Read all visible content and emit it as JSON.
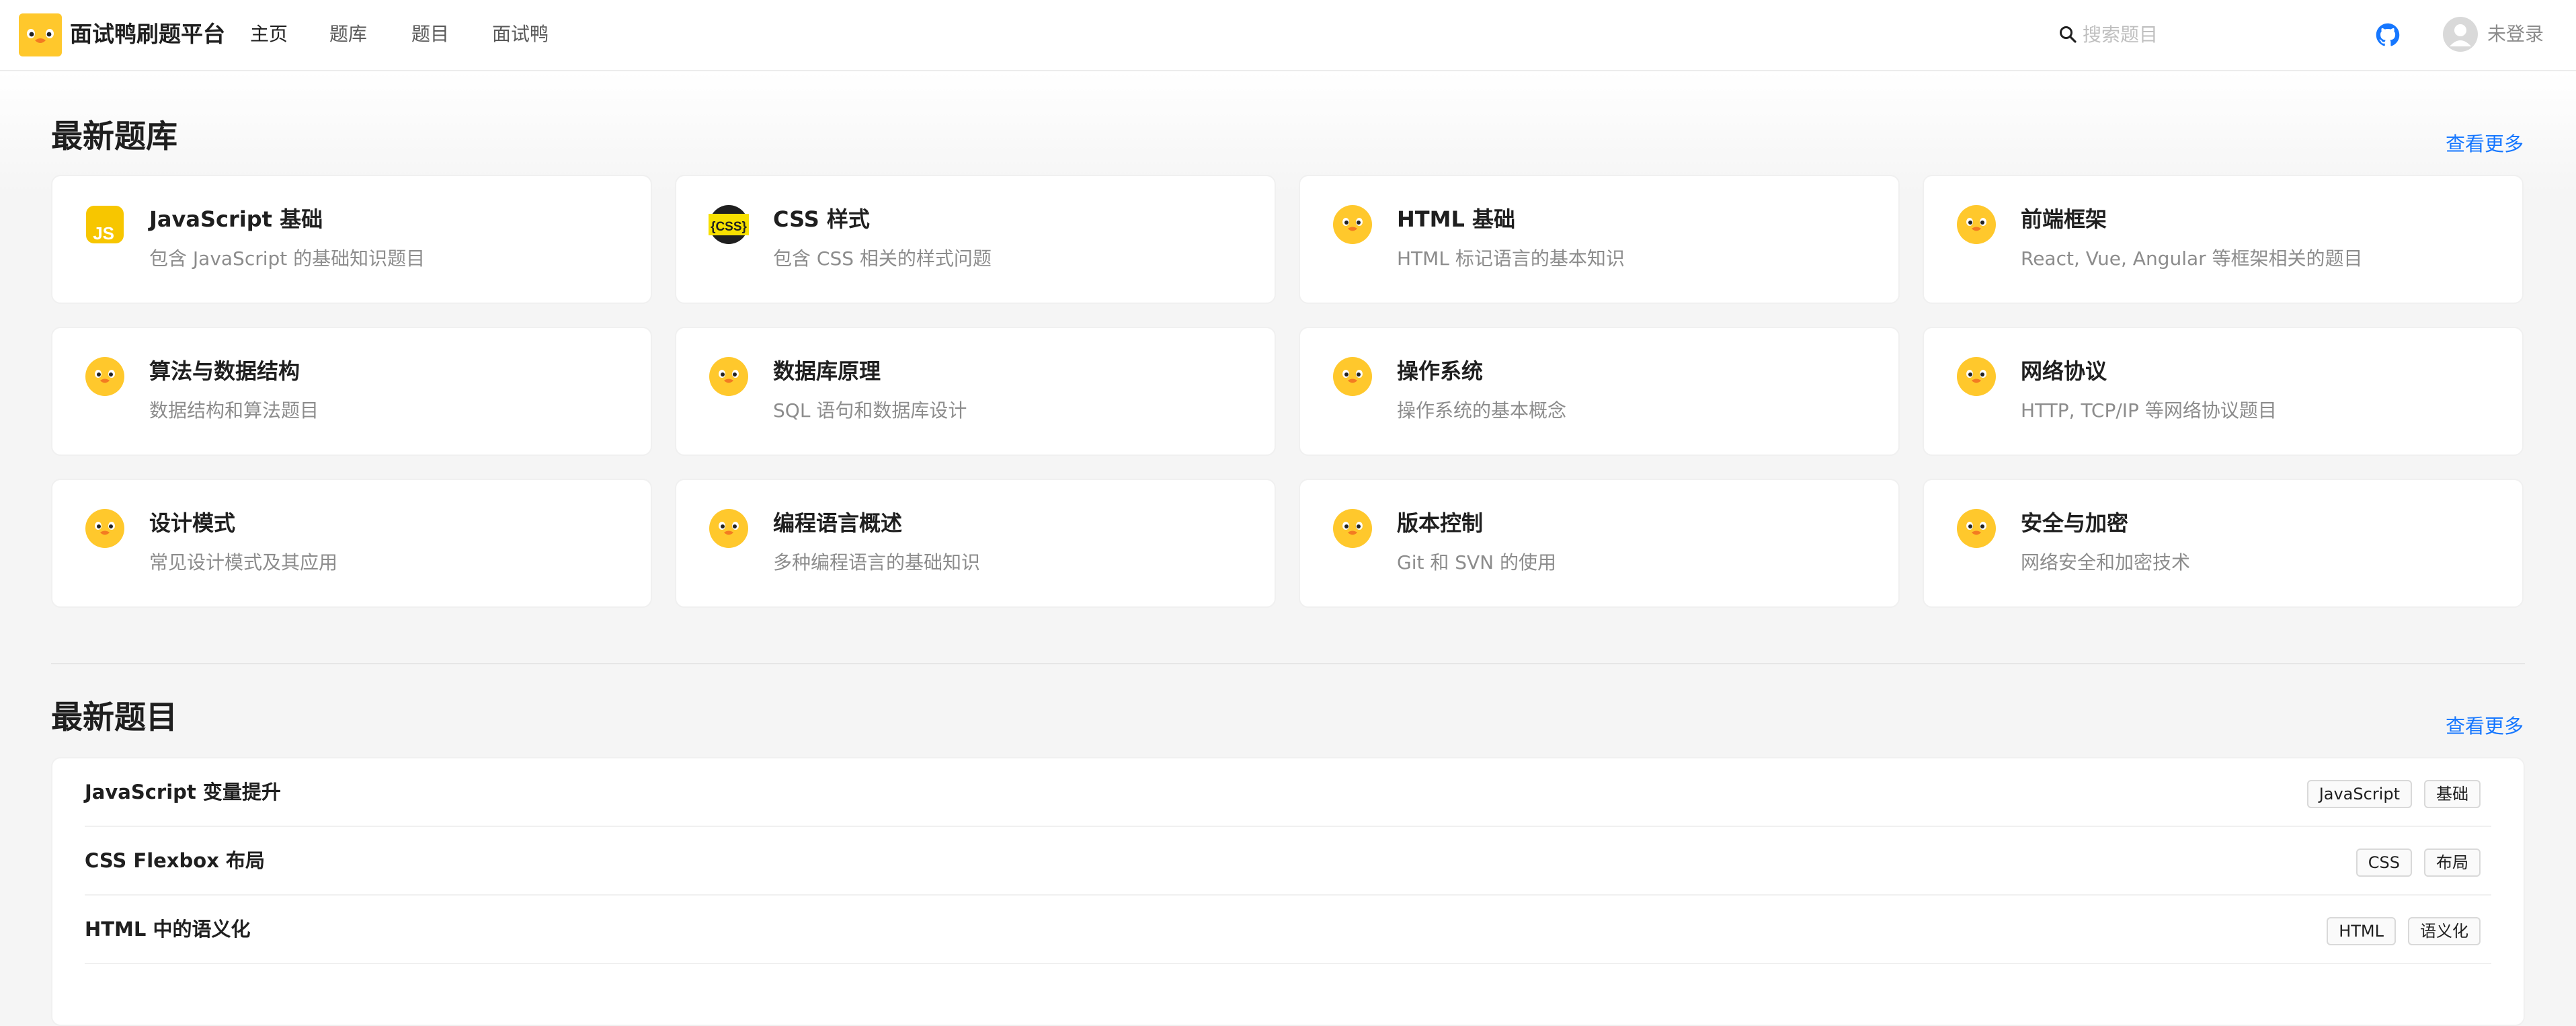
{
  "header": {
    "site_title": "面试鸭刷题平台",
    "nav": [
      {
        "label": "主页",
        "active": true
      },
      {
        "label": "题库",
        "active": false
      },
      {
        "label": "题目",
        "active": false
      },
      {
        "label": "面试鸭",
        "active": false
      }
    ],
    "search": {
      "placeholder": "搜索题目",
      "value": ""
    },
    "github_icon": "github-icon",
    "user": {
      "label": "未登录",
      "avatar_icon": "user-avatar-icon"
    }
  },
  "banks_section": {
    "title": "最新题库",
    "more": "查看更多",
    "items": [
      {
        "name": "JavaScript 基础",
        "desc": "包含 JavaScript 的基础知识题目",
        "icon": "js-logo-icon"
      },
      {
        "name": "CSS 样式",
        "desc": "包含 CSS 相关的样式问题",
        "icon": "css-logo-icon"
      },
      {
        "name": "HTML 基础",
        "desc": "HTML 标记语言的基本知识",
        "icon": "duck-icon"
      },
      {
        "name": "前端框架",
        "desc": "React, Vue, Angular 等框架相关的题目",
        "icon": "duck-icon"
      },
      {
        "name": "算法与数据结构",
        "desc": "数据结构和算法题目",
        "icon": "duck-icon"
      },
      {
        "name": "数据库原理",
        "desc": "SQL 语句和数据库设计",
        "icon": "duck-icon"
      },
      {
        "name": "操作系统",
        "desc": "操作系统的基本概念",
        "icon": "duck-icon"
      },
      {
        "name": "网络协议",
        "desc": "HTTP, TCP/IP 等网络协议题目",
        "icon": "duck-icon"
      },
      {
        "name": "设计模式",
        "desc": "常见设计模式及其应用",
        "icon": "duck-icon"
      },
      {
        "name": "编程语言概述",
        "desc": "多种编程语言的基础知识",
        "icon": "duck-icon"
      },
      {
        "name": "版本控制",
        "desc": "Git 和 SVN 的使用",
        "icon": "duck-icon"
      },
      {
        "name": "安全与加密",
        "desc": "网络安全和加密技术",
        "icon": "duck-icon"
      }
    ]
  },
  "questions_section": {
    "title": "最新题目",
    "more": "查看更多",
    "items": [
      {
        "title": "JavaScript 变量提升",
        "tags": [
          "JavaScript",
          "基础"
        ]
      },
      {
        "title": "CSS Flexbox 布局",
        "tags": [
          "CSS",
          "布局"
        ]
      },
      {
        "title": "HTML 中的语义化",
        "tags": [
          "HTML",
          "语义化"
        ]
      }
    ]
  },
  "colors": {
    "accent": "#1677ff",
    "duck_yellow": "#ffc82c",
    "page_background": "#f5f5f5"
  }
}
